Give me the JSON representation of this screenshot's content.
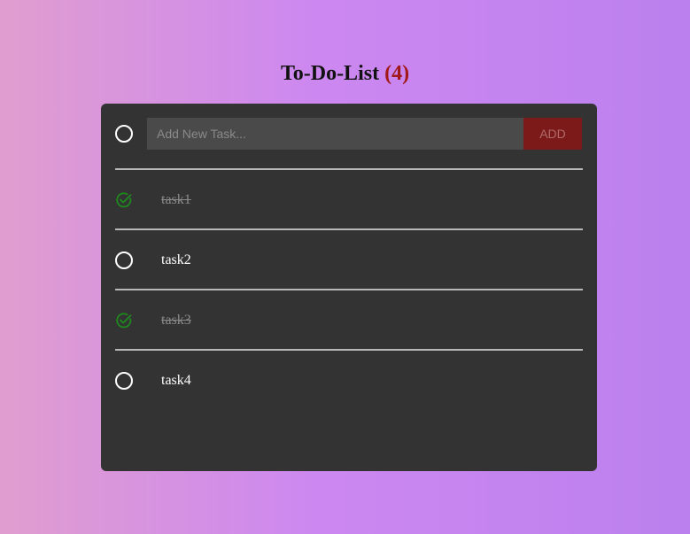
{
  "header": {
    "title": "To-Do-List",
    "count": "(4)"
  },
  "input": {
    "placeholder": "Add New Task...",
    "value": "",
    "add_label": "ADD"
  },
  "tasks": [
    {
      "label": "task1",
      "done": true
    },
    {
      "label": "task2",
      "done": false
    },
    {
      "label": "task3",
      "done": true
    },
    {
      "label": "task4",
      "done": false
    }
  ],
  "colors": {
    "card_bg": "#333333",
    "accent_red": "#7c1a1a",
    "count_red": "#a01818",
    "check_green": "#1e8a1e"
  },
  "icons": {
    "unchecked": "circle-icon",
    "checked": "check-circle-icon"
  }
}
